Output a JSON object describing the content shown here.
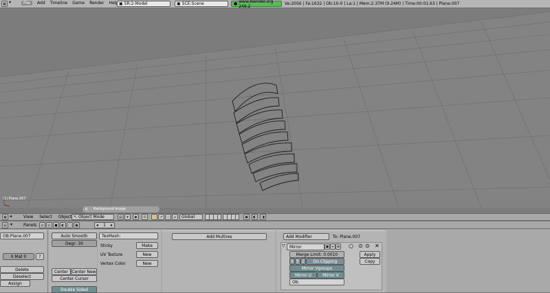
{
  "topbar": {
    "menus": [
      "File",
      "Add",
      "Timeline",
      "Game",
      "Render",
      "Help"
    ],
    "active_menu": "File",
    "screen": "SR:2-Model",
    "scene": "SCE:Scene",
    "url": "www.blender.org 249.2",
    "stats": "Ve:2056 | Fa:1632 | Ob:10-0 | La:1  | Mem:2.37M (9.24M) | Time:00:01.63 | Plane.007"
  },
  "viewport": {
    "object_label": "(1) Plane.007",
    "background_image_label": "Background Image"
  },
  "view3d_header": {
    "menus": [
      "View",
      "Select",
      "Object"
    ],
    "mode": "Object Mode",
    "orientation": "Global"
  },
  "buttons_header": {
    "panels_label": "Panels",
    "frame": "1"
  },
  "link_panel": {
    "object_name": "OB:Plane.007",
    "material_index": "0 Mat 0",
    "material_arrow": "?",
    "delete": "Delete",
    "deselect": "Deselect",
    "assign": "Assign"
  },
  "mesh_panel": {
    "auto_smooth": "Auto Smooth",
    "degr": "Degr: 30",
    "center": "Center",
    "center_new": "Center New",
    "center_cursor": "Center Cursor",
    "double_sided": "Double Sided"
  },
  "texmesh_panel": {
    "texmesh": "TexMesh:",
    "sticky": "Sticky",
    "make": "Make",
    "uv_texture": "UV Texture",
    "new1": "New",
    "vertex_color": "Vertex Color",
    "new2": "New"
  },
  "multires": {
    "add_multires": "Add Multires"
  },
  "modifiers": {
    "add_modifier": "Add Modifier",
    "to": "To: Plane.007",
    "modifier_name": "Mirror",
    "merge_limit": "Merge Limit: 0.0010",
    "x": "X",
    "y": "Y",
    "z": "Z",
    "do_clipping": "Do Clipping",
    "mirror_vgroups": "Mirror Vgroups",
    "mirror_u": "Mirror U",
    "mirror_v": "Mirror V",
    "ob": "Ob:",
    "apply": "Apply",
    "copy": "Copy"
  }
}
